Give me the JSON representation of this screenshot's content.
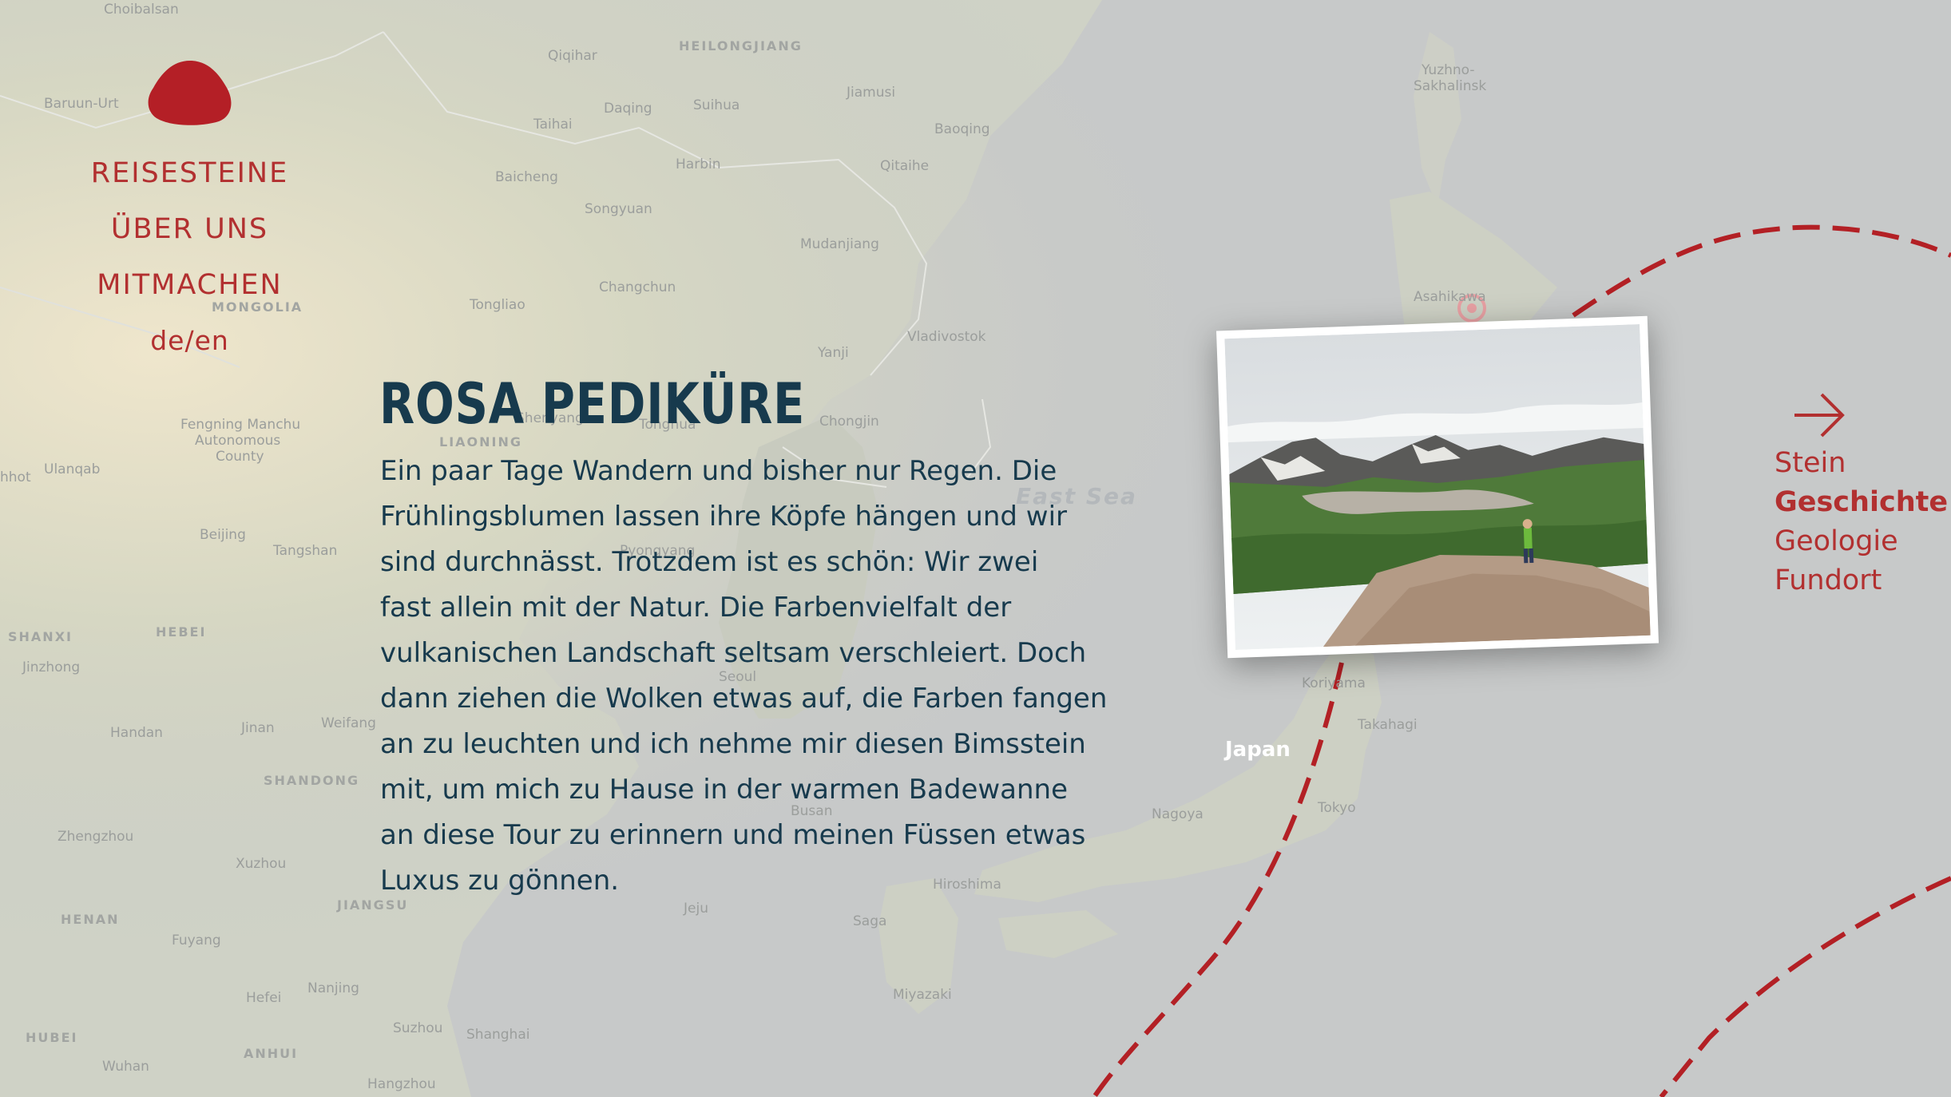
{
  "colors": {
    "accent": "#b23030",
    "heading": "#173a4d",
    "map_bg": "#c9cbca",
    "route": "#b32025"
  },
  "nav": {
    "logo_icon": "red-stone-icon",
    "items": [
      {
        "label": "REISESTEINE"
      },
      {
        "label": "ÜBER UNS"
      },
      {
        "label": "MITMACHEN"
      }
    ],
    "language": "de/en"
  },
  "story": {
    "title": "ROSA PEDIKÜRE",
    "lines": [
      "Ein paar Tage Wandern und bisher nur Regen. Die",
      "Frühlingsblumen lassen ihre Köpfe hängen und wir",
      "sind durchnässt. Trotzdem ist es schön: Wir zwei",
      "fast allein mit der Natur. Die Farbenvielfalt der",
      "vulkanischen Landschaft seltsam verschleiert. Doch",
      "dann ziehen die Wolken etwas auf, die Farben fangen",
      "an zu leuchten und ich nehme mir diesen Bimsstein",
      "mit, um mich zu Hause in der warmen Badewanne",
      "an diese Tour zu erinnern und meinen Füssen etwas",
      "Luxus zu gönnen."
    ]
  },
  "side_nav": {
    "arrow_icon": "arrow-right-icon",
    "items": [
      {
        "label": "Stein",
        "active": false
      },
      {
        "label": "Geschichte",
        "active": true
      },
      {
        "label": "Geologie",
        "active": false
      },
      {
        "label": "Fundort",
        "active": false
      }
    ]
  },
  "map": {
    "labels": [
      "Choibalsan",
      "HEILONGJIANG",
      "Qiqihar",
      "Yuzhno-",
      "Sakhalinsk",
      "Baruun-Urt",
      "Jiamusi",
      "Daqing",
      "Suihua",
      "Baoqing",
      "Taihai",
      "Harbin",
      "Qitaihe",
      "Baicheng",
      "Songyuan",
      "Mudanjiang",
      "Changchun",
      "Asahikawa",
      "MONGOLIA",
      "Tongliao",
      "Vladivostok",
      "Yanji",
      "Fengning Manchu",
      "Autonomous",
      "County",
      "Shenyang",
      "Tonghua",
      "Chongjin",
      "LIAONING",
      "Ulanqab",
      "hhot",
      "East Sea",
      "Beijing",
      "Tangshan",
      "Pyongyang",
      "SHANXI",
      "HEBEI",
      "Jinzhong",
      "Seoul",
      "Koriyama",
      "Jinan",
      "Weifang",
      "Takahagi",
      "Handan",
      "Japan",
      "SHANDONG",
      "Tokyo",
      "Nagoya",
      "Busan",
      "Zhengzhou",
      "Xuzhou",
      "Hiroshima",
      "Jeju",
      "JIANGSU",
      "HENAN",
      "Fuyang",
      "Saga",
      "Miyazaki",
      "Nanjing",
      "Hefei",
      "HUBEI",
      "Suzhou",
      "Shanghai",
      "ANHUI",
      "Wuhan",
      "Hangzhou"
    ]
  }
}
